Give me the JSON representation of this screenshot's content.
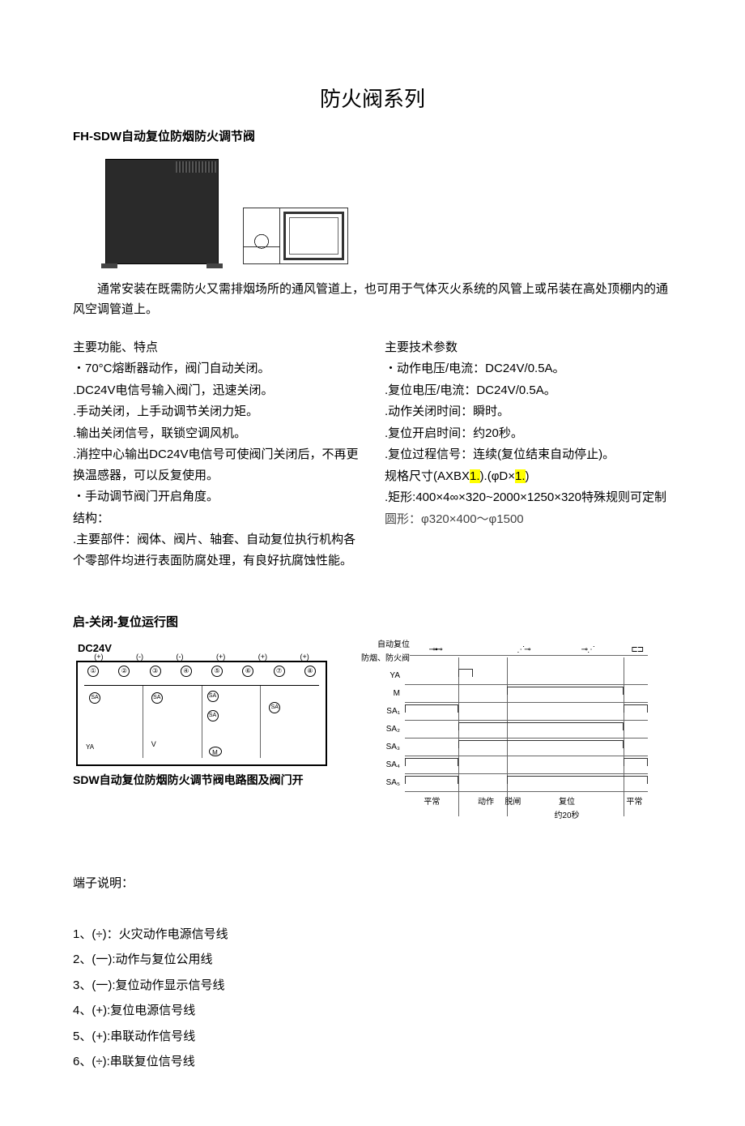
{
  "title": "防火阀系列",
  "subtitle": "FH-SDW自动复位防烟防火调节阀",
  "intro": "通常安装在既需防火又需排烟场所的通风管道上，也可用于气体灭火系统的风管上或吊装在高处顶棚内的通风空调管道上。",
  "left_col": {
    "h": "主要功能、特点",
    "items": [
      "・70°C熔断器动作，阀门自动关闭。",
      ".DC24V电信号输入阀门，迅速关闭。",
      ".手动关闭，上手动调节关闭力矩。",
      ".输出关闭信号，联锁空调风机。",
      ".消控中心输出DC24V电信号可使阀门关闭后，不再更换温感器，可以反复使用。",
      "・手动调节阀门开启角度。"
    ],
    "struct_h": "结构：",
    "struct_body": ".主要部件：阀体、阀片、轴套、自动复位执行机构各个零部件均进行表面防腐处理，有良好抗腐蚀性能。"
  },
  "right_col": {
    "h": "主要技术参数",
    "items": [
      "・动作电压/电流：DC24V/0.5A。",
      ".复位电压/电流：DC24V/0.5A。",
      ".动作关闭时间：瞬时。",
      ".复位开启时间：约20秒。"
    ],
    "signal_pre": ".复位过程信号：",
    "signal_hl": "连续(复位结束自动停止)",
    "signal_post": "。",
    "spec_pre": "规格尺寸(AXBX",
    "spec_1": "1.",
    "spec_mid": ").(φD×",
    "spec_2": "1.",
    "spec_post": ")",
    "rect": ".矩形:400×4∞×320~2000×1250×320特殊规则可定制",
    "circ": "圆形：φ320×400～φ1500"
  },
  "ops_title": "启-关闭-复位运行图",
  "circuit_power": "DC24V",
  "circuit_caption": "SDW自动复位防烟防火调节阀电路图及阀门开",
  "circuit": {
    "polarity": [
      "(+)",
      "(-)",
      "(-)",
      "(+)",
      "(+)",
      "(+)"
    ],
    "terminals": [
      "①",
      "②",
      "③",
      "④",
      "⑤",
      "⑥",
      "⑦",
      "⑧"
    ],
    "sym_sa": "SA",
    "sym_ya": "YA",
    "sym_v": "V",
    "sym_m": "M"
  },
  "timing": {
    "top1": "自动复位",
    "top2": "防烟、防火阀",
    "rows": [
      "YA",
      "M",
      "SA₁",
      "SA₂",
      "SA₃",
      "SA₄",
      "SA₅"
    ],
    "axis": [
      "平常",
      "动作",
      "复位",
      "平常"
    ],
    "brace": "脱闸",
    "reset_time": "约20秒"
  },
  "terminal_h": "端子说明：",
  "terminals": [
    "1、(÷)：火灾动作电源信号线",
    "2、(一):动作与复位公用线",
    "3、(一):复位动作显示信号线",
    "4、(+):复位电源信号线",
    "5、(+):串联动作信号线",
    "6、(÷):串联复位信号线"
  ]
}
